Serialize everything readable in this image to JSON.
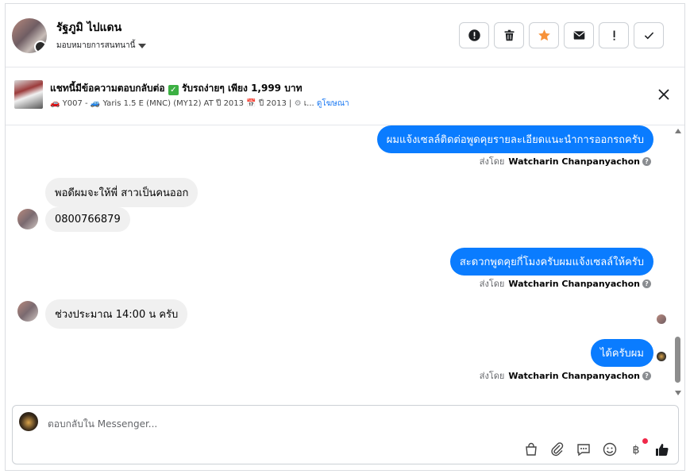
{
  "header": {
    "contact_name": "รัฐภูมิ ไปแดน",
    "assign_label": "มอบหมายการสนทนานี้",
    "actions": [
      "mark-spam",
      "delete",
      "star",
      "mark-unread",
      "follow-up",
      "mark-done"
    ]
  },
  "banner": {
    "title": "แชทนี้มีข้อความตอบกลับต่อ",
    "title_extra": "รับรถง่ายๆ เพียง 1,999 บาท",
    "sub_code": "Y007 -",
    "sub_model": "Yaris 1.5 E (MNC) (MY12) AT ปี 2013",
    "sub_year": "ปี 2013 |",
    "sub_more": "เ...",
    "ad_link": "ดูโฆษณา"
  },
  "messages": [
    {
      "dir": "out",
      "text": "ผมแจ้งเซลล์ติดต่อพูดคุยรายละเอียดแนะนำการออกรถครับ"
    },
    {
      "sent_prefix": "ส่งโดย",
      "sender": "Watcharin Chanpanyachon"
    },
    {
      "dir": "in",
      "text": "พอดีผมจะให้พี่ สาวเป็นคนออก"
    },
    {
      "dir": "in",
      "text": "0800766879"
    },
    {
      "dir": "out",
      "text": "สะดวกพูดคุยกี่โมงครับผมแจ้งเซลล์ให้ครับ"
    },
    {
      "sent_prefix": "ส่งโดย",
      "sender": "Watcharin Chanpanyachon"
    },
    {
      "dir": "in",
      "text": "ช่วงประมาณ 14:00 น ครับ"
    },
    {
      "dir": "out",
      "text": "ได้ครับผม"
    },
    {
      "sent_prefix": "ส่งโดย",
      "sender": "Watcharin Chanpanyachon"
    }
  ],
  "composer": {
    "placeholder": "ตอบกลับใน Messenger..."
  },
  "colors": {
    "outgoing_bubble": "#0a7cff",
    "incoming_bubble": "#f0f0f0",
    "star": "#f7923a",
    "like": "#1c1e21",
    "notification_dot": "#f02849"
  }
}
